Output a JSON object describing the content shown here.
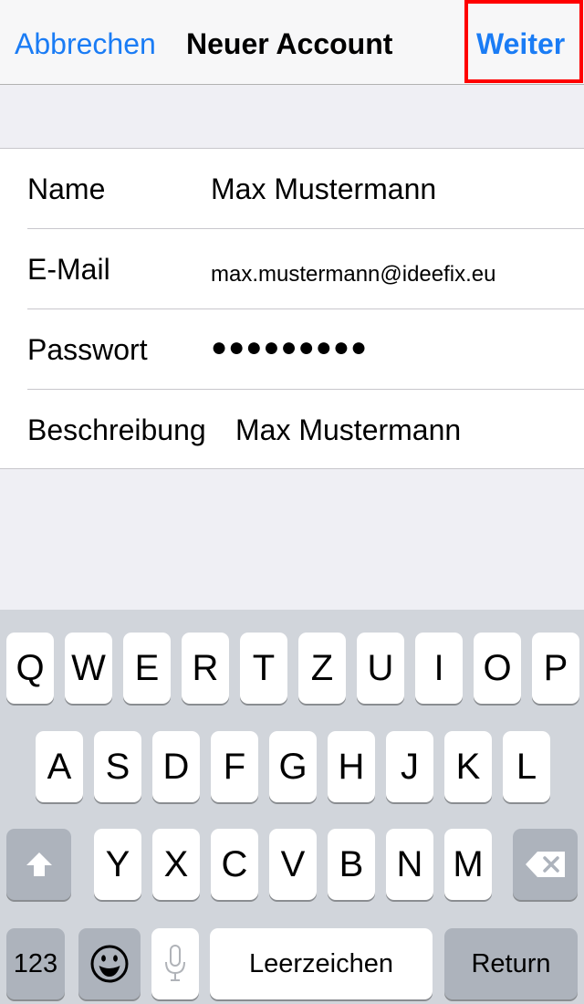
{
  "navbar": {
    "cancel": "Abbrechen",
    "title": "Neuer Account",
    "next": "Weiter"
  },
  "form": {
    "rows": [
      {
        "label": "Name",
        "value": "Max Mustermann"
      },
      {
        "label": "E-Mail",
        "value": "max.mustermann@ideefix.eu"
      },
      {
        "label": "Passwort",
        "value": "●●●●●●●●●"
      },
      {
        "label": "Beschreibung",
        "value": "Max Mustermann"
      }
    ]
  },
  "keyboard": {
    "row1": [
      "Q",
      "W",
      "E",
      "R",
      "T",
      "Z",
      "U",
      "I",
      "O",
      "P"
    ],
    "row2": [
      "A",
      "S",
      "D",
      "F",
      "G",
      "H",
      "J",
      "K",
      "L"
    ],
    "row3": [
      "Y",
      "X",
      "C",
      "V",
      "B",
      "N",
      "M"
    ],
    "numbers": "123",
    "space": "Leerzeichen",
    "return": "Return",
    "icons": {
      "shift": "shift-icon",
      "delete": "delete-icon",
      "emoji": "emoji-icon",
      "dictation": "microphone-icon"
    }
  },
  "colors": {
    "accent": "#1a7cf5",
    "highlight": "#ff0000",
    "keyboard_bg": "#d1d5db",
    "background": "#efeff4"
  }
}
